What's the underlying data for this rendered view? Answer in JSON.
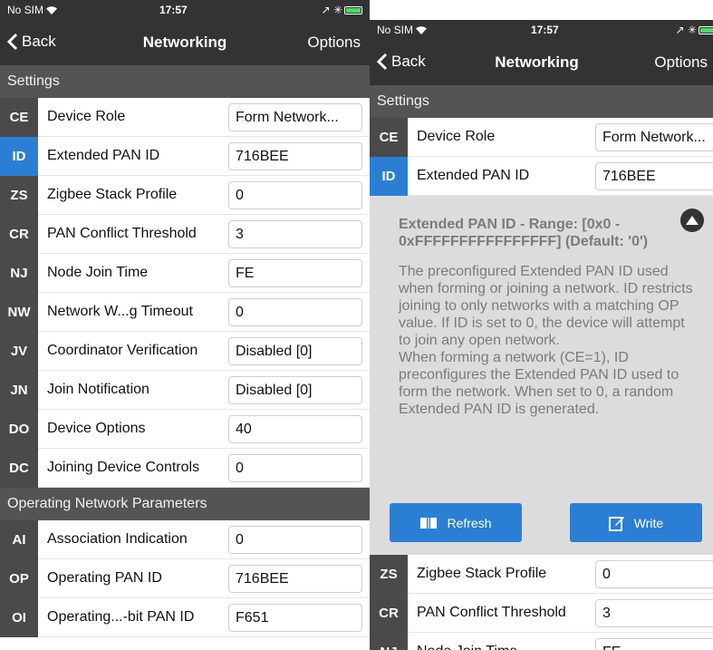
{
  "status": {
    "carrier": "No SIM",
    "time": "17:57"
  },
  "nav": {
    "back": "Back",
    "title": "Networking",
    "options": "Options"
  },
  "left": {
    "sections": [
      {
        "header": "Settings",
        "rows": [
          {
            "code": "CE",
            "label": "Device Role",
            "value": "Form Network...",
            "active": false
          },
          {
            "code": "ID",
            "label": "Extended PAN ID",
            "value": "716BEE",
            "active": true
          },
          {
            "code": "ZS",
            "label": "Zigbee Stack Profile",
            "value": "0",
            "active": false
          },
          {
            "code": "CR",
            "label": "PAN Conflict Threshold",
            "value": "3",
            "active": false
          },
          {
            "code": "NJ",
            "label": "Node Join Time",
            "value": "FE",
            "active": false
          },
          {
            "code": "NW",
            "label": "Network W...g Timeout",
            "value": "0",
            "active": false
          },
          {
            "code": "JV",
            "label": "Coordinator Verification",
            "value": "Disabled [0]",
            "active": false
          },
          {
            "code": "JN",
            "label": "Join Notification",
            "value": "Disabled [0]",
            "active": false
          },
          {
            "code": "DO",
            "label": "Device Options",
            "value": "40",
            "active": false
          },
          {
            "code": "DC",
            "label": "Joining Device Controls",
            "value": "0",
            "active": false
          }
        ]
      },
      {
        "header": "Operating Network Parameters",
        "rows": [
          {
            "code": "AI",
            "label": "Association Indication",
            "value": "0",
            "active": false
          },
          {
            "code": "OP",
            "label": "Operating PAN ID",
            "value": "716BEE",
            "active": false
          },
          {
            "code": "OI",
            "label": "Operating...-bit PAN ID",
            "value": "F651",
            "active": false
          }
        ]
      }
    ]
  },
  "right": {
    "header": "Settings",
    "top_rows": [
      {
        "code": "CE",
        "label": "Device Role",
        "value": "Form Network...",
        "active": false
      },
      {
        "code": "ID",
        "label": "Extended PAN ID",
        "value": "716BEE",
        "active": true
      }
    ],
    "info": {
      "title": "Extended PAN ID - Range: [0x0 - 0xFFFFFFFFFFFFFFFF] (Default: '0')",
      "body": "The preconfigured Extended PAN ID used when forming or joining a network. ID restricts joining to only networks with a matching OP value. If ID is set to 0, the device will attempt to join any open network.\nWhen forming a network (CE=1), ID preconfigures the Extended PAN ID used to form the network. When set to 0, a random Extended PAN ID is generated.",
      "refresh": "Refresh",
      "write": "Write"
    },
    "bottom_rows": [
      {
        "code": "ZS",
        "label": "Zigbee Stack Profile",
        "value": "0",
        "active": false
      },
      {
        "code": "CR",
        "label": "PAN Conflict Threshold",
        "value": "3",
        "active": false
      },
      {
        "code": "NJ",
        "label": "Node Join Time",
        "value": "FE",
        "active": false
      }
    ]
  },
  "colors": {
    "accent": "#2a7fd4",
    "bar": "#333333",
    "section": "#545454",
    "badge": "#4a4a4a",
    "info_bg": "#dcdcdc"
  }
}
